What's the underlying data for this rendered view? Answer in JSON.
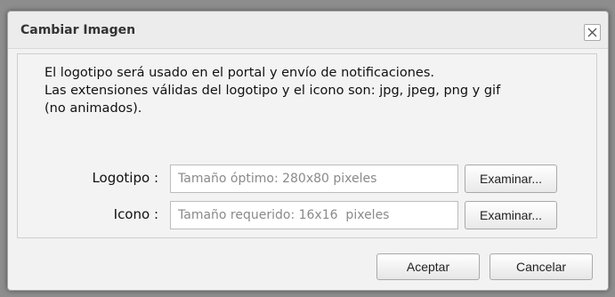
{
  "dialog": {
    "title": "Cambiar Imagen",
    "close_icon": "close-icon"
  },
  "message": {
    "line1": "El logotipo será usado en el portal y envío de notificaciones.",
    "line2": "Las extensiones válidas del logotipo y el icono son: jpg, jpeg, png y gif",
    "line3": "(no animados)."
  },
  "fields": {
    "logo": {
      "label": "Logotipo :",
      "value": "",
      "placeholder": "Tamaño óptimo: 280x80 pixeles",
      "browse_label": "Examinar..."
    },
    "icon": {
      "label": "Icono :",
      "value": "",
      "placeholder": "Tamaño requerido: 16x16  pixeles",
      "browse_label": "Examinar..."
    }
  },
  "buttons": {
    "accept_label": "Aceptar",
    "cancel_label": "Cancelar"
  }
}
